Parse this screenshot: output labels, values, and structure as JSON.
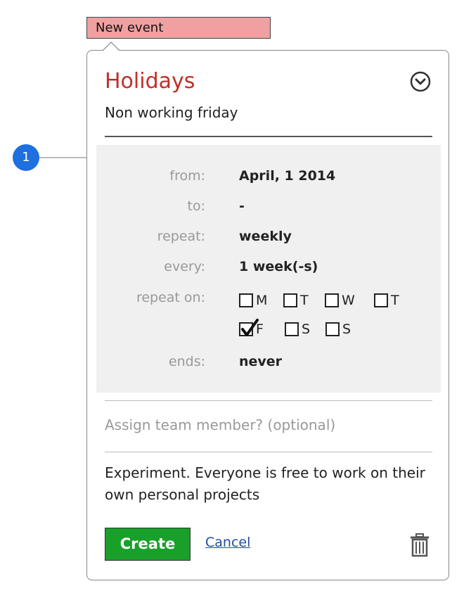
{
  "tag": {
    "label": "New event"
  },
  "marker": {
    "label": "1"
  },
  "event": {
    "title": "Holidays",
    "subtitle": "Non working friday"
  },
  "details": {
    "from_label": "from:",
    "from_value": "April, 1 2014",
    "to_label": "to:",
    "to_value": "-",
    "repeat_label": "repeat:",
    "repeat_value": "weekly",
    "every_label": "every:",
    "every_value": "1 week(-s)",
    "repeat_on_label": "repeat on:",
    "days": [
      {
        "letter": "M",
        "checked": false
      },
      {
        "letter": "T",
        "checked": false
      },
      {
        "letter": "W",
        "checked": false
      },
      {
        "letter": "T",
        "checked": false
      },
      {
        "letter": "F",
        "checked": true
      },
      {
        "letter": "S",
        "checked": false
      },
      {
        "letter": "S",
        "checked": false
      }
    ],
    "ends_label": "ends:",
    "ends_value": "never"
  },
  "assign": {
    "placeholder": "Assign team member? (optional)"
  },
  "description": "Experiment. Everyone is free to work on their own personal projects",
  "actions": {
    "create_label": "Create",
    "cancel_label": "Cancel"
  },
  "colors": {
    "title": "#c0302b",
    "tag": "#f0a0a0",
    "create": "#18a02a",
    "marker": "#1e6fe0"
  },
  "icons": {
    "expand": "chevron-down-circle-icon",
    "delete": "trash-icon",
    "check": "checkmark-icon"
  }
}
